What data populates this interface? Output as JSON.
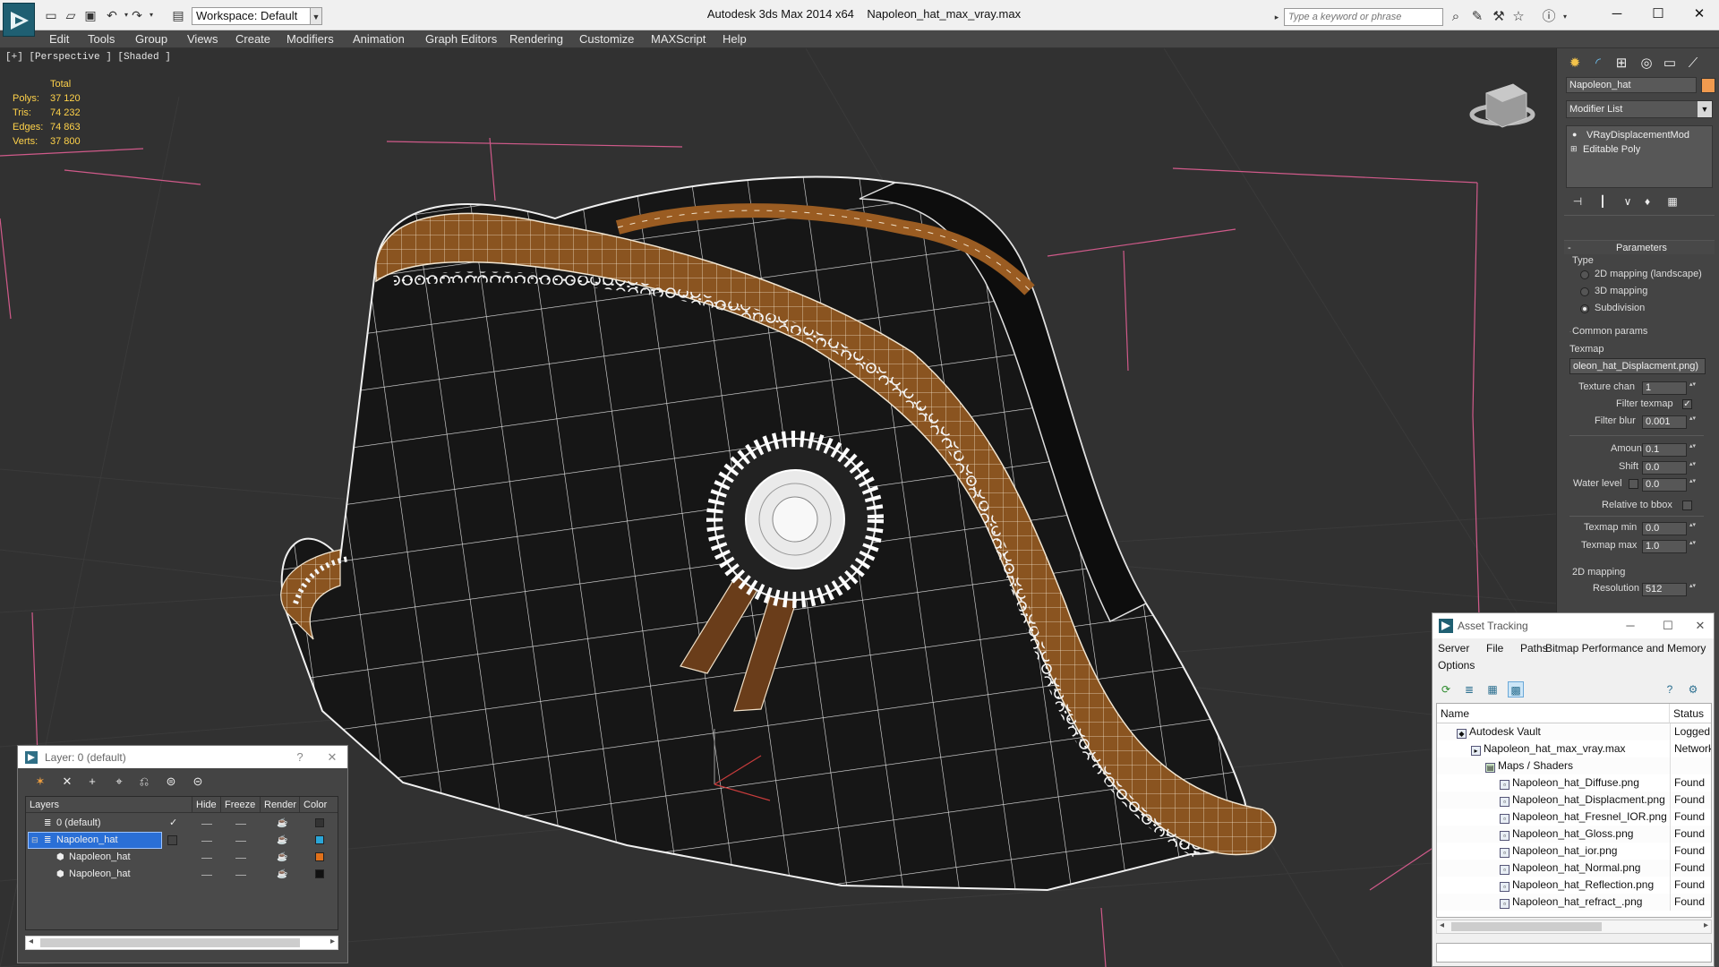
{
  "window": {
    "app_title": "Autodesk 3ds Max  2014 x64",
    "file_title": "Napoleon_hat_max_vray.max",
    "workspace": "Workspace: Default",
    "search_placeholder": "Type a keyword or phrase"
  },
  "menu": [
    "Edit",
    "Tools",
    "Group",
    "Views",
    "Create",
    "Modifiers",
    "Animation",
    "Graph Editors",
    "Rendering",
    "Customize",
    "MAXScript",
    "Help"
  ],
  "viewport": {
    "label": "[+] [Perspective ] [Shaded ]",
    "stats_header": "Total",
    "stats": [
      {
        "label": "Polys:",
        "value": "37 120"
      },
      {
        "label": "Tris:",
        "value": "74 232"
      },
      {
        "label": "Edges:",
        "value": "74 863"
      },
      {
        "label": "Verts:",
        "value": "37 800"
      }
    ]
  },
  "command_panel": {
    "object_name": "Napoleon_hat",
    "object_color": "#f09a4f",
    "modifier_list": "Modifier List",
    "stack": [
      "VRayDisplacementMod",
      "Editable Poly"
    ],
    "rollout_parameters": "Parameters",
    "type_label": "Type",
    "type_options": [
      {
        "label": "2D mapping (landscape)",
        "selected": false
      },
      {
        "label": "3D mapping",
        "selected": false
      },
      {
        "label": "Subdivision",
        "selected": true
      }
    ],
    "common_params": "Common params",
    "texmap_label": "Texmap",
    "texmap_value": "oleon_hat_Displacment.png)",
    "texture_chan_label": "Texture chan",
    "texture_chan_value": "1",
    "filter_texmap_label": "Filter texmap",
    "filter_blur_label": "Filter blur",
    "filter_blur_value": "0.001",
    "amount_label": "Amount",
    "amount_value": "0.1",
    "shift_label": "Shift",
    "shift_value": "0.0",
    "water_level_label": "Water level",
    "water_level_value": "0.0",
    "relative_bbox_label": "Relative to bbox",
    "texmap_min_label": "Texmap min",
    "texmap_min_value": "0.0",
    "texmap_max_label": "Texmap max",
    "texmap_max_value": "1.0",
    "mapping_2d_label": "2D mapping",
    "resolution_label": "Resolution",
    "resolution_value": "512"
  },
  "asset_tracking": {
    "title": "Asset Tracking",
    "menu": [
      "Server",
      "File",
      "Paths",
      "Bitmap Performance and Memory",
      "Options"
    ],
    "col_name": "Name",
    "col_status": "Status",
    "rows": [
      {
        "name": "Autodesk Vault",
        "status": "Logged Out"
      },
      {
        "name": "Napoleon_hat_max_vray.max",
        "status": "Network"
      },
      {
        "name": "Maps / Shaders",
        "status": ""
      },
      {
        "name": "Napoleon_hat_Diffuse.png",
        "status": "Found"
      },
      {
        "name": "Napoleon_hat_Displacment.png",
        "status": "Found"
      },
      {
        "name": "Napoleon_hat_Fresnel_IOR.png",
        "status": "Found"
      },
      {
        "name": "Napoleon_hat_Gloss.png",
        "status": "Found"
      },
      {
        "name": "Napoleon_hat_ior.png",
        "status": "Found"
      },
      {
        "name": "Napoleon_hat_Normal.png",
        "status": "Found"
      },
      {
        "name": "Napoleon_hat_Reflection.png",
        "status": "Found"
      },
      {
        "name": "Napoleon_hat_refract_.png",
        "status": "Found"
      }
    ]
  },
  "layer_explorer": {
    "title": "Layer: 0 (default)",
    "help": "?",
    "columns": {
      "layers": "Layers",
      "hide": "Hide",
      "freeze": "Freeze",
      "render": "Render",
      "color": "Color"
    },
    "rows": [
      {
        "name": "0 (default)",
        "color": "#333333",
        "selected": false
      },
      {
        "name": "Napoleon_hat",
        "color": "#2aa6d8",
        "selected": true
      },
      {
        "name": "Napoleon_hat",
        "color": "#e0701a",
        "selected": false
      },
      {
        "name": "Napoleon_hat",
        "color": "#111111",
        "selected": false
      }
    ]
  }
}
